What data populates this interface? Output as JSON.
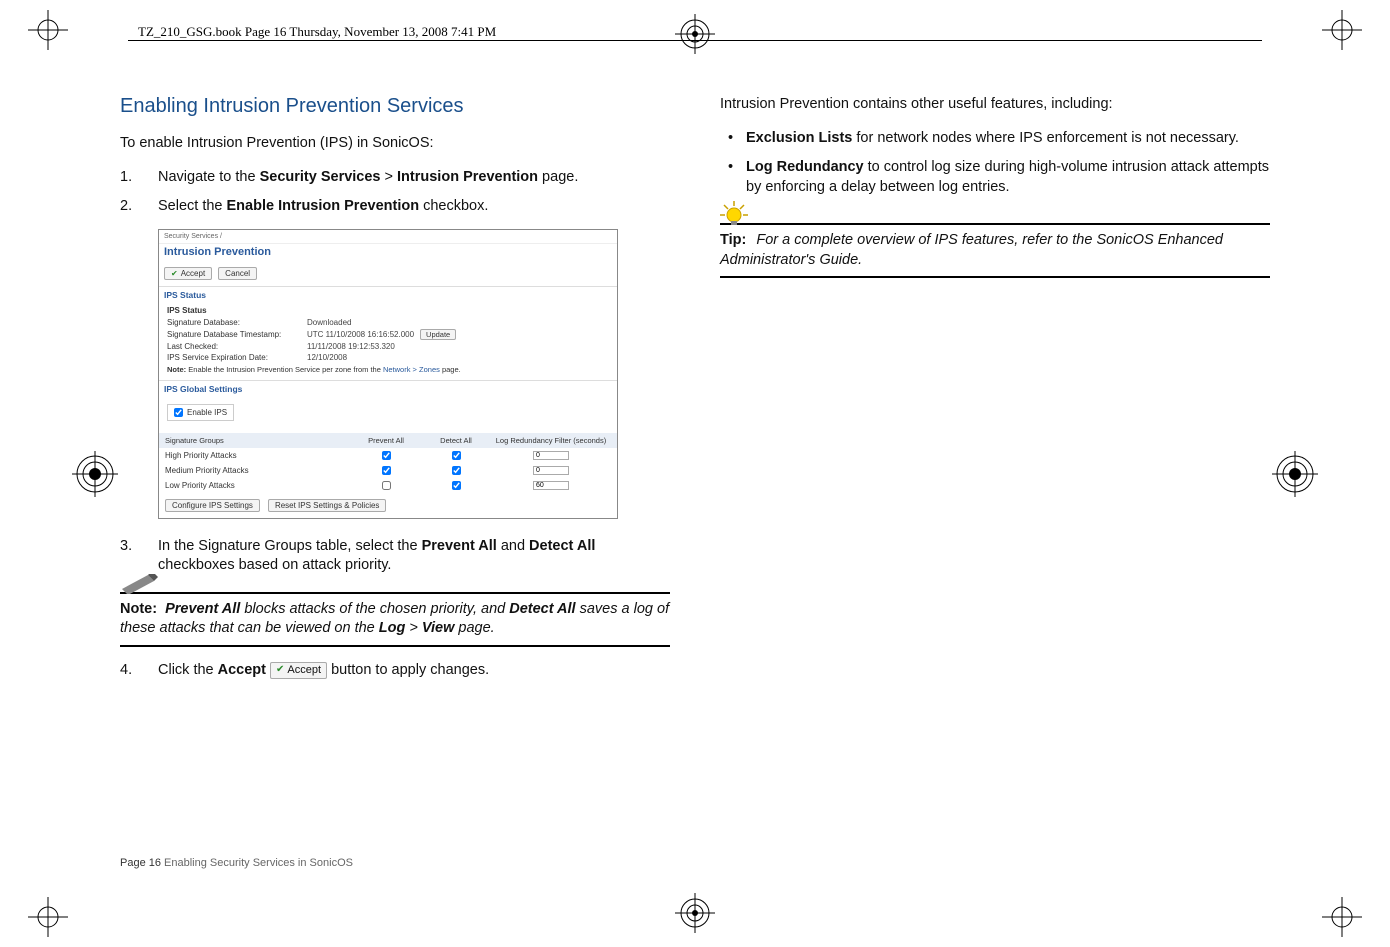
{
  "header": {
    "filemeta": "TZ_210_GSG.book  Page 16  Thursday, November 13, 2008  7:41 PM"
  },
  "left": {
    "heading": "Enabling Intrusion Prevention Services",
    "intro": "To enable Intrusion Prevention (IPS) in SonicOS:",
    "steps": {
      "s1a": "Navigate to the ",
      "s1b": "Security Services",
      "s1c": " > ",
      "s1d": "Intrusion Prevention",
      "s1e": " page.",
      "s2a": "Select the ",
      "s2b": "Enable Intrusion Prevention",
      "s2c": " checkbox.",
      "s3a": "In the Signature Groups table, select the ",
      "s3b": "Prevent All",
      "s3c": " and ",
      "s3d": "Detect All",
      "s3e": " checkboxes based on attack priority.",
      "s4a": "Click the ",
      "s4b": "Accept",
      "s4c": " ",
      "s4d": "button to apply changes.",
      "accept_inline": "Accept"
    },
    "screenshot": {
      "breadcrumb": "Security Services /",
      "title": "Intrusion Prevention",
      "accept_btn": "Accept",
      "cancel_btn": "Cancel",
      "section_status": "IPS Status",
      "status_block": "IPS Status",
      "sig_db_label": "Signature Database:",
      "sig_db_val": "Downloaded",
      "sig_ts_label": "Signature Database Timestamp:",
      "sig_ts_val": "UTC 11/10/2008 16:16:52.000",
      "update_btn": "Update",
      "last_checked_label": "Last Checked:",
      "last_checked_val": "11/11/2008 19:12:53.320",
      "exp_label": "IPS Service Expiration Date:",
      "exp_val": "12/10/2008",
      "note_prefix": "Note:",
      "note_text": "Enable the Intrusion Prevention Service per zone from the ",
      "note_link": "Network > Zones",
      "note_text2": " page.",
      "section_global": "IPS Global Settings",
      "enable_ips": "Enable IPS",
      "col_groups": "Signature Groups",
      "col_prevent": "Prevent All",
      "col_detect": "Detect All",
      "col_redund": "Log Redundancy Filter (seconds)",
      "row_high": "High Priority Attacks",
      "row_med": "Medium Priority Attacks",
      "row_low": "Low Priority Attacks",
      "val_high": "0",
      "val_med": "0",
      "val_low": "60",
      "btn_conf": "Configure IPS Settings",
      "btn_reset": "Reset IPS Settings & Policies"
    },
    "note": {
      "label": "Note:",
      "body1": "Prevent All",
      "body2": " blocks attacks of the chosen priority, and ",
      "body3": "Detect All",
      "body4": " saves a log of these attacks that can be viewed on the ",
      "body5": "Log",
      "body6": " > ",
      "body7": "View",
      "body8": " page."
    }
  },
  "right": {
    "intro": "Intrusion Prevention contains other useful features, including:",
    "b1a": "Exclusion Lists",
    "b1b": " for network nodes where IPS enforcement is not necessary.",
    "b2a": "Log Redundancy",
    "b2b": " to control log size during high-volume intrusion attack attempts by enforcing a delay between log entries.",
    "tip": {
      "label": "Tip:",
      "body": "For a complete overview of IPS features, refer to the SonicOS Enhanced Administrator's Guide."
    }
  },
  "footer": {
    "page": "Page 16",
    "text": "  Enabling Security Services in SonicOS"
  }
}
